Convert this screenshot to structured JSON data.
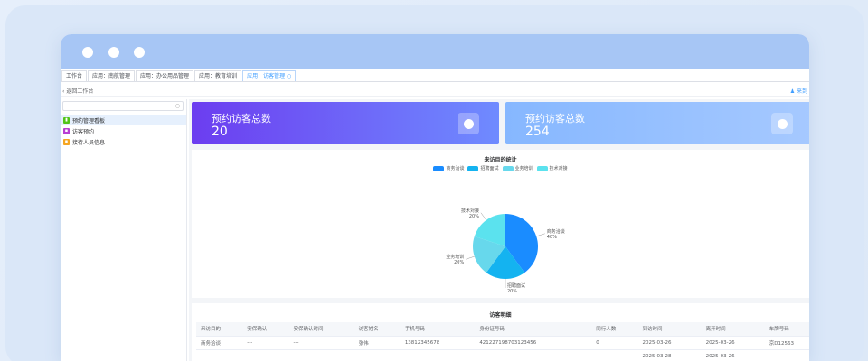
{
  "tabs": [
    "工作台",
    "应用：南航管理",
    "应用：办公用品管理",
    "应用：教育培训",
    "应用：访客管理 ○"
  ],
  "breadcrumb": {
    "back_label": "返回工作台",
    "user_label": "♟ 来到"
  },
  "sidebar": {
    "items": [
      {
        "label": "预约管理看板",
        "icon": "chart-icon",
        "color": "#52c41a"
      },
      {
        "label": "访客预约",
        "icon": "calendar-icon",
        "color": "#b83fd4"
      },
      {
        "label": "接待人员信息",
        "icon": "user-card-icon",
        "color": "#f5a623"
      }
    ]
  },
  "stats": [
    {
      "label": "预约访客总数",
      "value": "20",
      "gradient": [
        "#6c3df0",
        "#6f8bff"
      ]
    },
    {
      "label": "预约访客总数",
      "value": "254",
      "gradient": [
        "#86b7ff",
        "#a6c9ff"
      ]
    }
  ],
  "chart_data": {
    "type": "pie",
    "title": "来访目的统计",
    "categories": [
      "商务洽谈",
      "招聘面试",
      "业务培训",
      "技术对接"
    ],
    "values": [
      40,
      20,
      20,
      20
    ],
    "labels": [
      "商务洽谈\n40%",
      "招聘面试\n20%",
      "业务培训\n20%",
      "技术对接\n20%"
    ],
    "colors": [
      "#1a8cff",
      "#14b3f0",
      "#67d8ec",
      "#5be2ee"
    ],
    "legend_position": "top-center"
  },
  "table": {
    "title": "访客明细",
    "columns": [
      "来访目的",
      "安保确认",
      "安保确认时间",
      "访客姓名",
      "手机号码",
      "身份证号码",
      "同行人数",
      "到访时间",
      "离开时间",
      "车牌号码"
    ],
    "rows": [
      [
        "商务洽谈",
        "---",
        "---",
        "张伟",
        "13812345678",
        "421227198703123456",
        "0",
        "2025-03-26",
        "2025-03-26",
        "京D12563"
      ],
      [
        "",
        "",
        "",
        "",
        "",
        "",
        "",
        "2025-03-28",
        "2025-03-26",
        ""
      ]
    ]
  }
}
